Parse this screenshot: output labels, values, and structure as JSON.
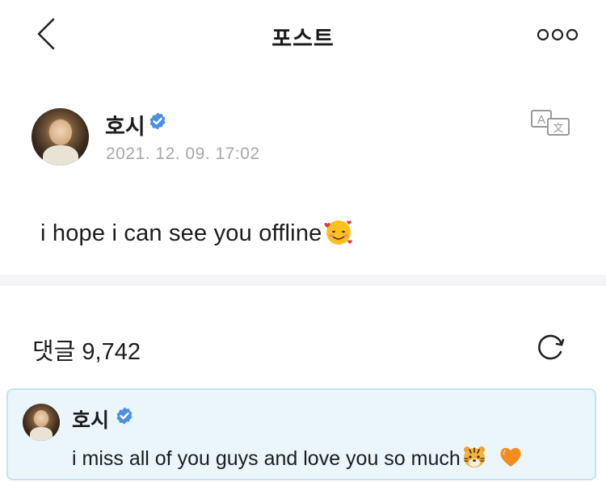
{
  "header": {
    "title": "포스트",
    "back_icon": "chevron-left-icon",
    "more_icon": "more-horizontal-icon"
  },
  "post": {
    "author": "호시",
    "verified_icon": "verified-badge-icon",
    "timestamp": "2021. 12. 09. 17:02",
    "text": "i hope i can see you offline",
    "emoji": "smiling-face-with-hearts",
    "translate_icon": "translate-icon"
  },
  "comments": {
    "label": "댓글 9,742",
    "refresh_icon": "refresh-icon",
    "items": [
      {
        "author": "호시",
        "text": "i miss all of you guys and love you so much",
        "emojis": [
          "tiger-face",
          "orange-heart"
        ]
      }
    ]
  },
  "colors": {
    "verified": "#4a90e2",
    "timestamp": "#a8a8a8",
    "highlight_bg": "#eaf6fc",
    "highlight_border": "#c3e2f1",
    "divider": "#f4f4f6"
  }
}
